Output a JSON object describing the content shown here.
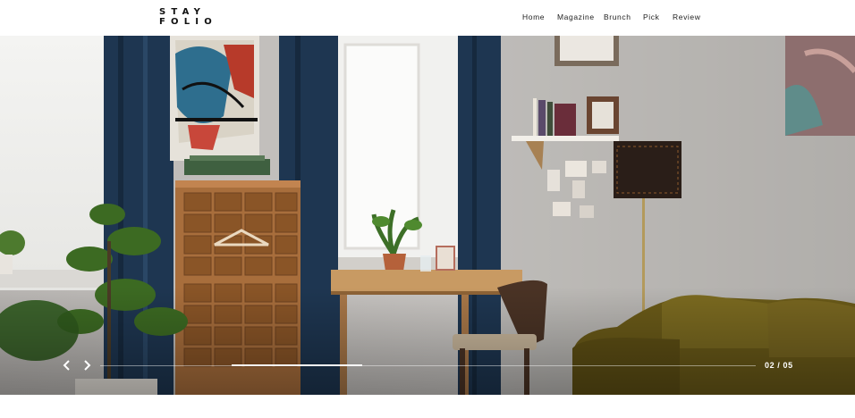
{
  "brand": {
    "logo_line1": "STAY",
    "logo_line2": "FOLIO"
  },
  "nav": {
    "items": [
      {
        "label": "Home"
      },
      {
        "label": "Magazine"
      },
      {
        "label": "Brunch"
      },
      {
        "label": "Pick"
      },
      {
        "label": "Review"
      }
    ]
  },
  "hero": {
    "progress_fraction": 0.2
  },
  "slider": {
    "current": "02",
    "separator": "/",
    "total": "05",
    "counter_text": "02 / 05"
  },
  "colors": {
    "wall": "#c4c1be",
    "curtain": "#1c3550",
    "wood": "#9a6a40",
    "sofa": "#6e5e1a"
  }
}
